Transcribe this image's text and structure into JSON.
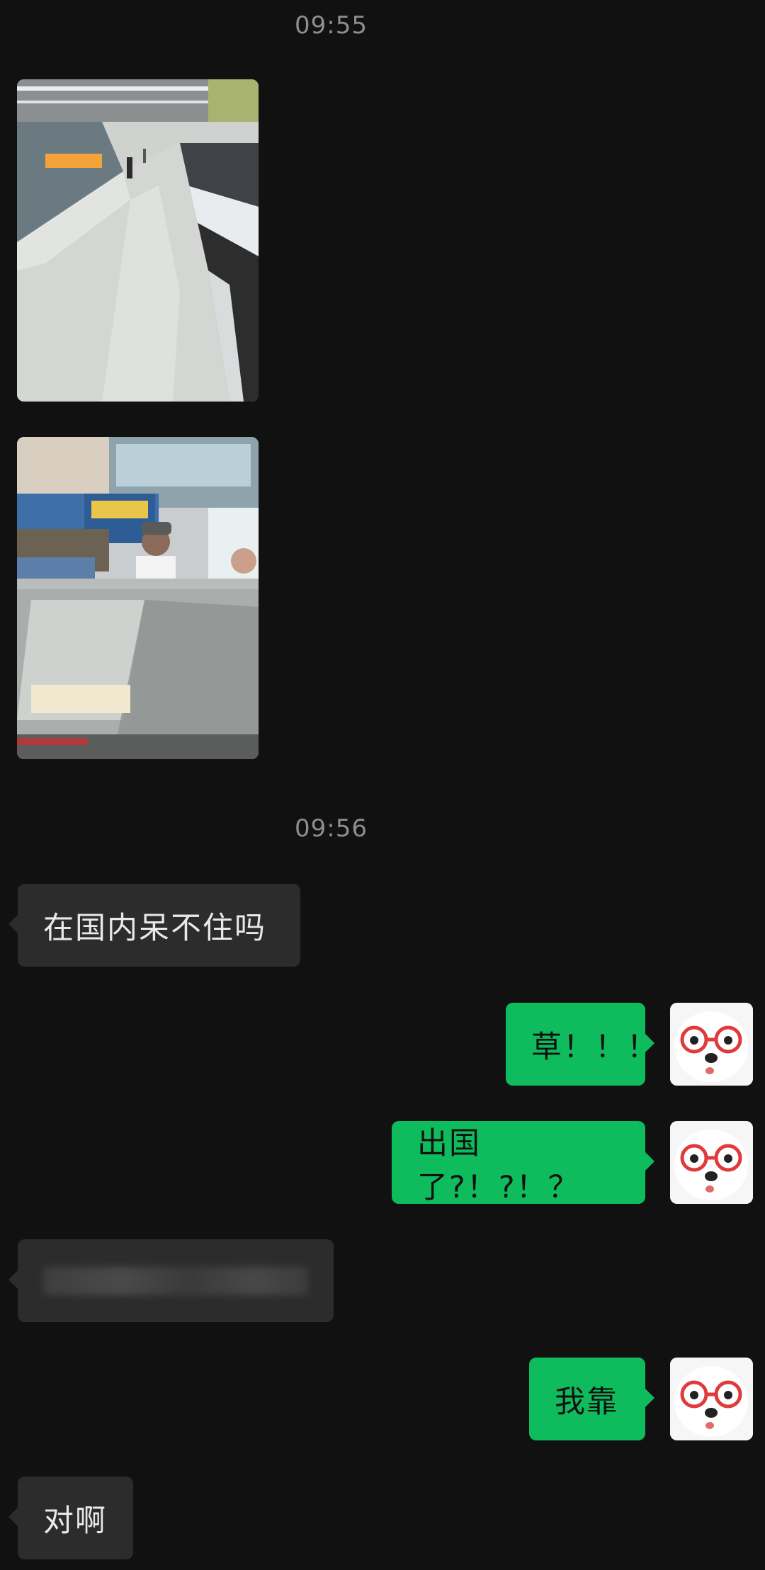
{
  "chat": {
    "timestamps": [
      "09:55",
      "09:56"
    ],
    "messages": {
      "m1": "在国内呆不住吗",
      "m2": "草！！！",
      "m3": "出国了?！?！？",
      "m4": "",
      "m5": "我靠",
      "m6": "对啊"
    }
  },
  "colors": {
    "background": "#111111",
    "incoming_bubble": "#2c2c2c",
    "outgoing_bubble": "#0fbc5d",
    "timestamp_text": "#8e8e8e"
  },
  "icons": {
    "avatar": "white-dog-with-red-glasses-avatar"
  }
}
